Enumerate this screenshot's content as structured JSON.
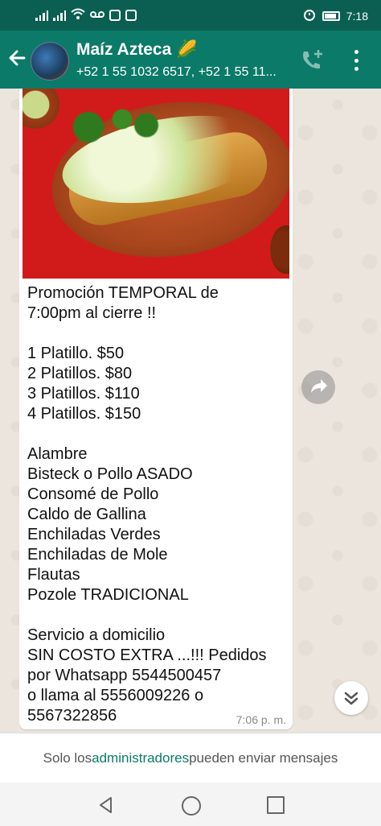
{
  "status_bar": {
    "time": "7:18"
  },
  "header": {
    "title": "Maíz Azteca 🌽",
    "subtitle": "+52 1 55 1032 6517, +52 1 55 11..."
  },
  "message": {
    "text": "Promoción TEMPORAL de\n7:00pm al cierre !!\n\n1 Platillo.    $50\n2 Platillos.  $80\n3 Platillos.  $110\n4 Platillos.  $150\n\nAlambre\nBisteck o Pollo ASADO\nConsomé de Pollo\nCaldo de Gallina\nEnchiladas Verdes\nEnchiladas de Mole\nFlautas\nPozole TRADICIONAL\n\nServicio a domicilio\nSIN COSTO EXTRA ...!!! Pedidos\npor Whatsapp 5544500457\no llama al 5556009226 o\n5567322856",
    "time": "7:06 p. m."
  },
  "footer": {
    "prefix": "Solo los ",
    "admins": "administradores",
    "suffix": " pueden enviar mensajes"
  },
  "colors": {
    "header": "#0b7a69",
    "status": "#0b5f52",
    "chat_bg": "#ece5dd"
  }
}
